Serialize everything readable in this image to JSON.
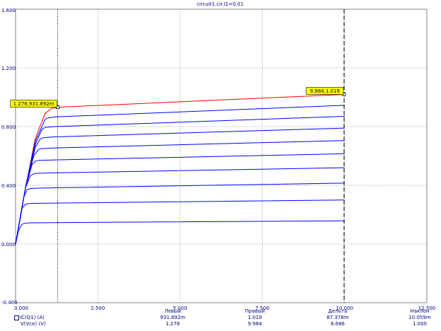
{
  "title": "circuit1.cir.I1=0.01",
  "chart_data": {
    "type": "line",
    "xlim": [
      0,
      12.5
    ],
    "ylim": [
      -0.4,
      1.6
    ],
    "x_ticks": [
      "0.000",
      "2.500",
      "5.000",
      "7.500",
      "10.000",
      "12.500"
    ],
    "x_tick_values": [
      0,
      2.5,
      5,
      7.5,
      10,
      12.5
    ],
    "y_ticks": [
      "-0.400",
      "0.000",
      "0.400",
      "0.800",
      "1.200",
      "1.600"
    ],
    "y_tick_values": [
      -0.4,
      0,
      0.4,
      0.8,
      1.2,
      1.6
    ],
    "grid": true,
    "series": [
      {
        "color": "#ff0000",
        "x": [
          0,
          0.3,
          0.6,
          0.9,
          1.1,
          1.278,
          10
        ],
        "y": [
          0,
          0.38,
          0.72,
          0.89,
          0.925,
          0.932,
          1.019
        ]
      },
      {
        "color": "#0000ff",
        "x": [
          0,
          0.3,
          0.6,
          0.9,
          1.0,
          1.2,
          10
        ],
        "y": [
          0,
          0.38,
          0.7,
          0.85,
          0.86,
          0.866,
          0.945
        ]
      },
      {
        "color": "#0000ff",
        "x": [
          0,
          0.3,
          0.6,
          0.8,
          0.9,
          1.2,
          10
        ],
        "y": [
          0,
          0.38,
          0.68,
          0.78,
          0.795,
          0.8,
          0.87
        ]
      },
      {
        "color": "#0000ff",
        "x": [
          0,
          0.3,
          0.6,
          0.75,
          0.85,
          1.2,
          10
        ],
        "y": [
          0,
          0.38,
          0.66,
          0.715,
          0.725,
          0.73,
          0.79
        ]
      },
      {
        "color": "#0000ff",
        "x": [
          0,
          0.3,
          0.55,
          0.7,
          0.8,
          1.2,
          10
        ],
        "y": [
          0,
          0.38,
          0.6,
          0.645,
          0.65,
          0.655,
          0.705
        ]
      },
      {
        "color": "#0000ff",
        "x": [
          0,
          0.3,
          0.5,
          0.6,
          0.7,
          1.2,
          10
        ],
        "y": [
          0,
          0.38,
          0.54,
          0.565,
          0.57,
          0.573,
          0.615
        ]
      },
      {
        "color": "#0000ff",
        "x": [
          0,
          0.3,
          0.45,
          0.55,
          0.65,
          1.2,
          10
        ],
        "y": [
          0,
          0.38,
          0.465,
          0.478,
          0.482,
          0.485,
          0.52
        ]
      },
      {
        "color": "#0000ff",
        "x": [
          0,
          0.25,
          0.35,
          0.45,
          0.6,
          1.2,
          10
        ],
        "y": [
          0,
          0.32,
          0.37,
          0.378,
          0.38,
          0.383,
          0.415
        ]
      },
      {
        "color": "#0000ff",
        "x": [
          0,
          0.2,
          0.3,
          0.4,
          0.5,
          1.2,
          10
        ],
        "y": [
          0,
          0.245,
          0.27,
          0.275,
          0.277,
          0.279,
          0.3
        ]
      },
      {
        "color": "#0000ff",
        "x": [
          0,
          0.1,
          0.2,
          0.3,
          0.4,
          1.2,
          10
        ],
        "y": [
          0,
          0.1,
          0.135,
          0.142,
          0.144,
          0.146,
          0.158
        ]
      }
    ],
    "cursors": [
      {
        "x": 1.278,
        "y": 0.932,
        "label": "1.278,931.892m",
        "style": "dotted"
      },
      {
        "x": 9.984,
        "y": 1.019,
        "label": "9.984,1.019",
        "style": "dashed"
      }
    ]
  },
  "stats": {
    "headers": [
      "Левый",
      "Правый",
      "Дельта",
      "Наклон"
    ],
    "rows": [
      {
        "name": "IC(Q1) (A)",
        "values": [
          "931.892m",
          "1.019",
          "87.378m",
          "10.059m"
        ]
      },
      {
        "name": "V(Vce) (V)",
        "values": [
          "1.278",
          "9.984",
          "8.686",
          "1.000"
        ]
      }
    ]
  },
  "colors": {
    "axis_text": "#000080",
    "grid": "#808080",
    "selected_trace": "#ff0000",
    "trace": "#0000ff",
    "cursor_tag_bg": "#ffff00"
  }
}
